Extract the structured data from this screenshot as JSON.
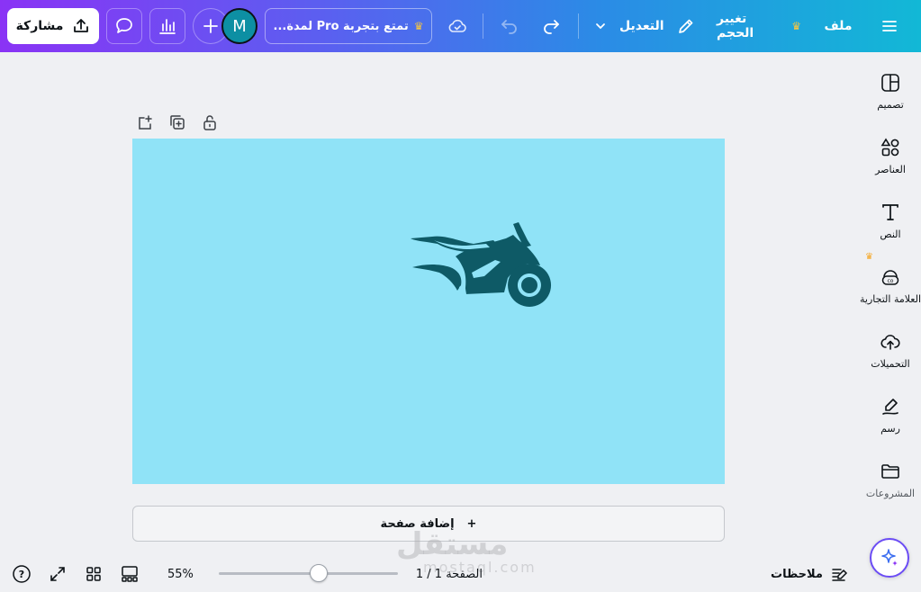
{
  "topbar": {
    "share_label": "مشاركة",
    "promo_label": "تمتع بتجربة Pro لمدة...",
    "edit_label": "التعديل",
    "resize_label": "تغيير الحجم",
    "file_label": "ملف",
    "avatar_initial": "M",
    "gradient_start": "#8a33f5",
    "gradient_end": "#12b8d6"
  },
  "sidebar": {
    "items": [
      {
        "label": "تصميم",
        "icon": "design-icon"
      },
      {
        "label": "العناصر",
        "icon": "elements-icon"
      },
      {
        "label": "النص",
        "icon": "text-icon"
      },
      {
        "label": "العلامة التجارية",
        "icon": "brand-icon"
      },
      {
        "label": "التحميلات",
        "icon": "uploads-icon"
      },
      {
        "label": "رسم",
        "icon": "draw-icon"
      },
      {
        "label": "المشروعات",
        "icon": "projects-icon"
      }
    ]
  },
  "canvas": {
    "background": "#90e3f7",
    "add_page_label": "إضافة صفحة",
    "add_page_plus": "+"
  },
  "watermark": {
    "text": "مستقل",
    "domain": "mostaql.com"
  },
  "bottombar": {
    "notes_label": "ملاحظات",
    "page_indicator": "الصفحة 1 / 1",
    "zoom_label": "55%",
    "zoom_fraction": 0.55,
    "help_label": "?"
  }
}
